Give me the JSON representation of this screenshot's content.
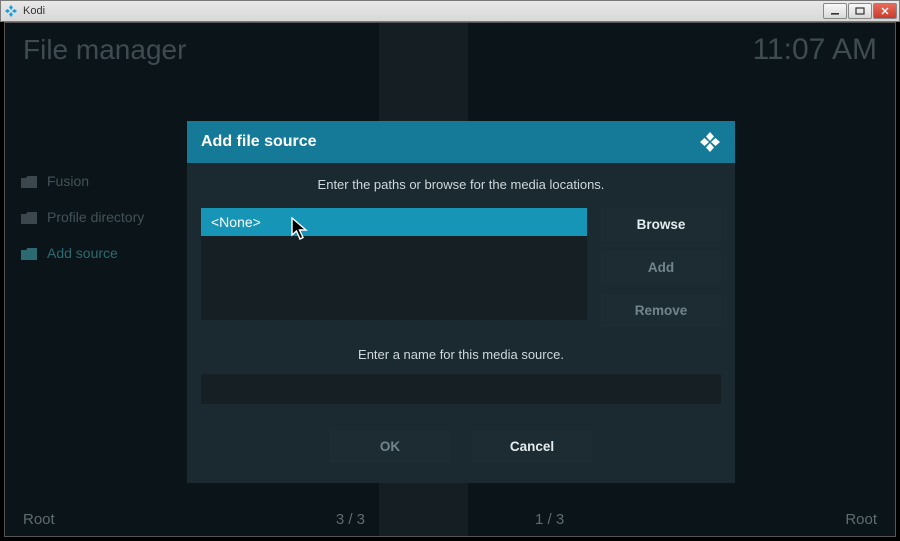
{
  "window": {
    "title": "Kodi"
  },
  "header": {
    "page_title": "File manager",
    "clock": "11:07 AM"
  },
  "sidebar": {
    "items": [
      {
        "label": "Fusion",
        "active": false
      },
      {
        "label": "Profile directory",
        "active": false
      },
      {
        "label": "Add source",
        "active": true
      }
    ]
  },
  "dialog": {
    "title": "Add file source",
    "instruction_top": "Enter the paths or browse for the media locations.",
    "paths": [
      {
        "label": "<None>"
      }
    ],
    "browse_label": "Browse",
    "add_label": "Add",
    "remove_label": "Remove",
    "instruction_name": "Enter a name for this media source.",
    "name_value": "",
    "ok_label": "OK",
    "cancel_label": "Cancel"
  },
  "footer": {
    "left": "Root",
    "center1": "3 / 3",
    "center2": "1 / 3",
    "right": "Root"
  }
}
